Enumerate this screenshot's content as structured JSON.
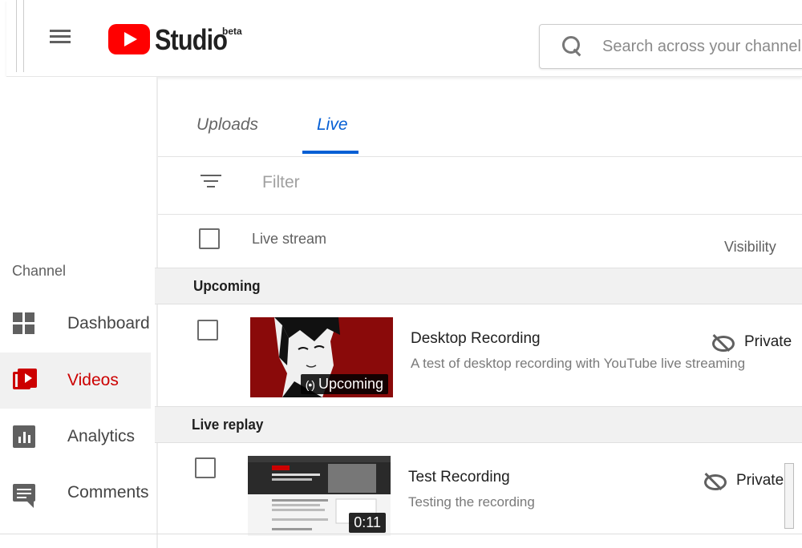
{
  "app": {
    "logo_text": "Studio",
    "logo_badge": "beta"
  },
  "search": {
    "placeholder": "Search across your channel"
  },
  "sidebar": {
    "section_label": "Channel",
    "items": [
      {
        "label": "Dashboard",
        "icon": "dashboard-icon"
      },
      {
        "label": "Videos",
        "icon": "videos-icon",
        "active": true
      },
      {
        "label": "Analytics",
        "icon": "analytics-icon"
      },
      {
        "label": "Comments",
        "icon": "comments-icon"
      }
    ]
  },
  "tabs": [
    {
      "label": "Uploads"
    },
    {
      "label": "Live",
      "active": true
    }
  ],
  "filter": {
    "placeholder": "Filter"
  },
  "table": {
    "columns": {
      "live_stream": "Live stream",
      "visibility": "Visibility"
    },
    "sections": [
      {
        "label": "Upcoming",
        "rows": [
          {
            "title": "Desktop Recording",
            "description": "A test of desktop recording with YouTube live streaming",
            "badge": "Upcoming",
            "badge_icon": "live-broadcast-icon",
            "visibility": "Private"
          }
        ]
      },
      {
        "label": "Live replay",
        "rows": [
          {
            "title": "Test Recording",
            "description": "Testing the recording",
            "badge": "0:11",
            "visibility": "Private"
          }
        ]
      }
    ]
  },
  "colors": {
    "accent_blue": "#065fd4",
    "brand_red": "#ff0000",
    "active_red": "#cc0000"
  }
}
